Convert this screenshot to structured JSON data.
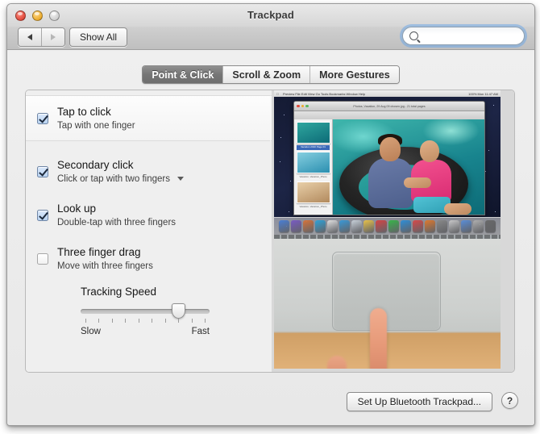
{
  "window": {
    "title": "Trackpad",
    "traffic_lights": [
      "close-button",
      "minimize-button",
      "zoom-button"
    ]
  },
  "toolbar": {
    "back_label": "◀",
    "forward_label": "▶",
    "show_all_label": "Show All",
    "search_value": "",
    "search_placeholder": ""
  },
  "tabs": [
    {
      "label": "Point & Click",
      "active": true
    },
    {
      "label": "Scroll & Zoom",
      "active": false
    },
    {
      "label": "More Gestures",
      "active": false
    }
  ],
  "gestures": [
    {
      "title": "Tap to click",
      "subtitle": "Tap with one finger",
      "checked": true,
      "selected": true,
      "has_popup": false
    },
    {
      "title": "Secondary click",
      "subtitle": "Click or tap with two fingers",
      "checked": true,
      "selected": false,
      "has_popup": true
    },
    {
      "title": "Look up",
      "subtitle": "Double-tap with three fingers",
      "checked": true,
      "selected": false,
      "has_popup": false
    },
    {
      "title": "Three finger drag",
      "subtitle": "Move with three fingers",
      "checked": false,
      "selected": false,
      "has_popup": false
    }
  ],
  "tracking_speed": {
    "label": "Tracking Speed",
    "min_label": "Slow",
    "max_label": "Fast",
    "tick_count": 10,
    "value_index": 7,
    "value_percent": 73
  },
  "preview": {
    "menubar": {
      "apple": "",
      "items": [
        "Preview",
        "File",
        "Edit",
        "View",
        "Go",
        "Tools",
        "Bookmarks",
        "Window",
        "Help"
      ],
      "status": [
        "100%",
        "Mon 11:47 AM"
      ]
    },
    "photo_window": {
      "title": "Photos, Vacation, 29 Aug 09 chosen.jpg - 21 total pages",
      "thumbnails": [
        {
          "caption": "Vacation 2010 Page 01",
          "selected": true
        },
        {
          "caption": "Vacation, Vacation_Photo",
          "selected": false
        },
        {
          "caption": "Vacation, Vacation_Photo",
          "selected": false
        }
      ]
    },
    "scene_caption": "Man and girl in an inner tube in the water; below, a trackpad being tapped by one finger"
  },
  "footer": {
    "setup_button": "Set Up Bluetooth Trackpad...",
    "help_button": "?"
  },
  "colors": {
    "accent_blue": "#70a8e6",
    "tab_active_bg": "#767676",
    "checkbox_blue": "#b9d3f1",
    "window_bg": "#ececec",
    "panel_bg": "#f0f0f0"
  }
}
